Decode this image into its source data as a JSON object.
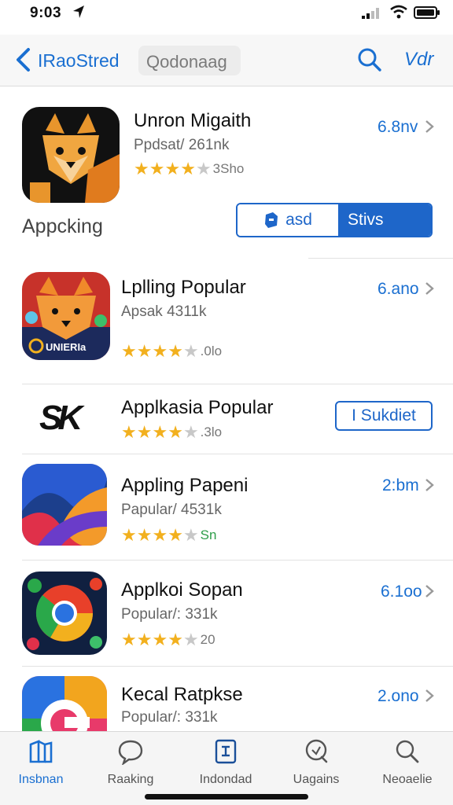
{
  "status_bar": {
    "time": "9:03",
    "icons": [
      "location-arrow-icon",
      "cellular-signal-icon",
      "wifi-icon",
      "battery-icon"
    ]
  },
  "nav": {
    "back_label": "IRaoStred",
    "search_text": "Qodonaag",
    "edit_label": "Vdr"
  },
  "section_label": "Appcking",
  "apps": [
    {
      "title": "Unron Migaith",
      "subtitle": "Ppdsat/ 261nk",
      "stars": 4,
      "rating_text": "3Sho",
      "price": "6.8nv"
    },
    {
      "title": "Lplling Popular",
      "subtitle": "Apsak 4311k",
      "icon_text": "UNIERIa",
      "stars": 4,
      "rating_text": ".0lo",
      "price": "6.ano"
    },
    {
      "title": "Applkasia Popular",
      "icon_text": "SK",
      "stars": 4,
      "rating_text": ".3lo",
      "button_label": "I Sukdiet"
    },
    {
      "title": "Appling Papeni",
      "subtitle": "Papular/ 4531k",
      "stars": 4,
      "rating_text": "Sn",
      "price": "2:bm"
    },
    {
      "title": "Applkoi Sopan",
      "subtitle": "Popular/: 331k",
      "stars": 4,
      "rating_text": "20",
      "price": "6.1oo"
    },
    {
      "title": "Kecal Ratpkse",
      "subtitle": "Popular/: 331k",
      "price": "2.ono"
    }
  ],
  "row1_actions": {
    "left_label": "asd",
    "right_label": "Stivs"
  },
  "tabs": [
    {
      "label": "Insbnan",
      "icon": "book-icon",
      "active": true
    },
    {
      "label": "Raaking",
      "icon": "chat-bubble-icon",
      "active": false
    },
    {
      "label": "Indondad",
      "icon": "document-icon",
      "active": false
    },
    {
      "label": "Uagains",
      "icon": "magnifier-icon",
      "active": false
    },
    {
      "label": "Neoaelie",
      "icon": "search-icon",
      "active": false
    }
  ],
  "colors": {
    "accent": "#1a6fd1",
    "star": "#f2b01e",
    "star_off": "#c8c8c8"
  }
}
